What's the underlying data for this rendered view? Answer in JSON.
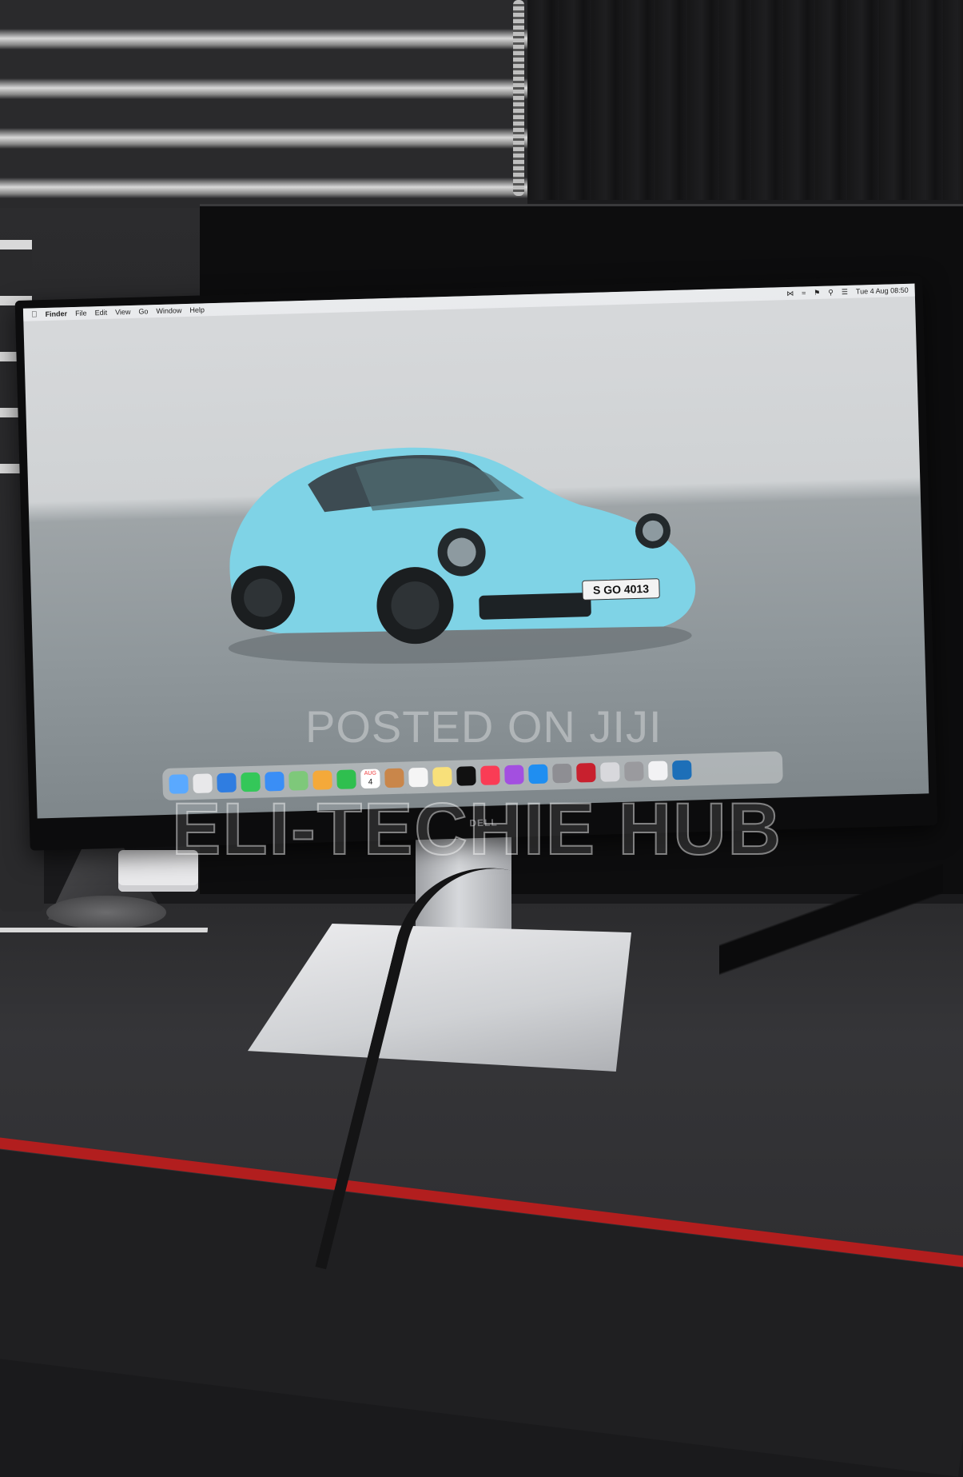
{
  "menubar": {
    "app": "Finder",
    "menus": [
      "File",
      "Edit",
      "View",
      "Go",
      "Window",
      "Help"
    ],
    "clock": "Tue 4 Aug  08:50"
  },
  "car": {
    "plate": "S GO 4013",
    "color": "#7fd3e6"
  },
  "dock": {
    "apps": [
      "finder-icon",
      "launchpad-icon",
      "safari-icon",
      "messages-icon",
      "mail-icon",
      "maps-icon",
      "photos-icon",
      "facetime-icon",
      "calendar-icon",
      "contacts-icon",
      "reminders-icon",
      "notes-icon",
      "tv-icon",
      "music-icon",
      "podcasts-icon",
      "app-store-icon",
      "system-preferences-icon",
      "dictionary-icon",
      "preview-icon",
      "automator-icon",
      "document-icon",
      "screen-icon"
    ],
    "calendar_month": "AUG",
    "calendar_day": "4"
  },
  "monitor_brand": "DELL",
  "watermarks": {
    "line1": "POSTED ON JIJI",
    "line2": "ELI-TECHIE HUB"
  },
  "colors": {
    "desk_edge": "#b21e1e",
    "car_body": "#7fd3e6"
  }
}
